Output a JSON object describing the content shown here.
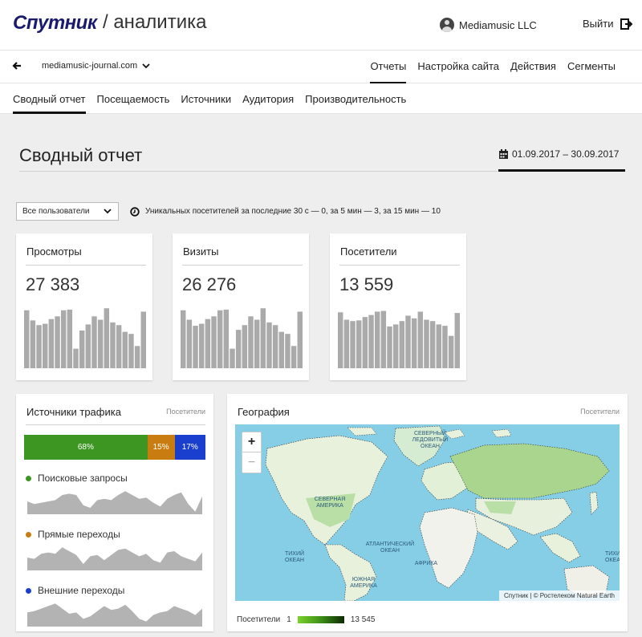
{
  "header": {
    "logo": "Спутник",
    "section": "/ аналитика",
    "account": "Mediamusic LLC",
    "logout": "Выйти"
  },
  "nav": {
    "site": "mediamusic-journal.com",
    "tabs": [
      "Отчеты",
      "Настройка сайта",
      "Действия",
      "Сегменты"
    ],
    "subtabs": [
      "Сводный отчет",
      "Посещаемость",
      "Источники",
      "Аудитория",
      "Производительность"
    ]
  },
  "page": {
    "title": "Сводный отчет",
    "date_range": "01.09.2017 – 30.09.2017"
  },
  "filter": {
    "segment": "Все пользователи",
    "realtime": "Уникальных посетителей за последние 30 с — 0, за 5 мин — 3, за 15 мин — 10"
  },
  "metrics": [
    {
      "title": "Просмотры",
      "value": "27 383",
      "bars": [
        0.86,
        0.71,
        0.64,
        0.66,
        0.73,
        0.77,
        0.86,
        0.87,
        0.29,
        0.56,
        0.65,
        0.77,
        0.72,
        0.89,
        0.68,
        0.64,
        0.54,
        0.51,
        0.33,
        0.84
      ]
    },
    {
      "title": "Визиты",
      "value": "26 276",
      "bars": [
        0.86,
        0.72,
        0.63,
        0.66,
        0.73,
        0.77,
        0.86,
        0.87,
        0.29,
        0.57,
        0.64,
        0.77,
        0.72,
        0.89,
        0.68,
        0.64,
        0.54,
        0.51,
        0.33,
        0.84
      ]
    },
    {
      "title": "Посетители",
      "value": "13 559",
      "bars": [
        0.83,
        0.72,
        0.7,
        0.71,
        0.76,
        0.79,
        0.84,
        0.85,
        0.62,
        0.65,
        0.7,
        0.78,
        0.74,
        0.84,
        0.72,
        0.7,
        0.65,
        0.63,
        0.48,
        0.82
      ]
    }
  ],
  "traffic": {
    "title": "Источники трафика",
    "subtitle": "Посетители",
    "segments": [
      {
        "label": "68%",
        "share": 0.68,
        "color": "#3c9621"
      },
      {
        "label": "15%",
        "share": 0.15,
        "color": "#c97d11"
      },
      {
        "label": "17%",
        "share": 0.17,
        "color": "#1a3fcf"
      }
    ],
    "sources": [
      {
        "name": "Поисковые запросы",
        "color": "#3c9621",
        "spark": [
          0.5,
          0.4,
          0.45,
          0.5,
          0.55,
          0.75,
          0.8,
          0.75,
          0.35,
          0.25,
          0.55,
          0.6,
          0.55,
          0.75,
          0.9,
          0.75,
          0.6,
          0.65,
          0.45,
          0.3,
          0.6,
          0.75,
          0.85,
          0.4,
          0.1,
          0.7
        ]
      },
      {
        "name": "Прямые переходы",
        "color": "#c97d11",
        "spark": [
          0.5,
          0.45,
          0.65,
          0.7,
          0.65,
          0.9,
          0.75,
          0.6,
          0.25,
          0.55,
          0.6,
          0.4,
          0.6,
          0.8,
          0.85,
          0.7,
          0.55,
          0.65,
          0.4,
          0.3,
          0.7,
          0.75,
          0.55,
          0.45,
          0.35,
          0.7
        ]
      },
      {
        "name": "Внешние переходы",
        "color": "#1a3fcf",
        "spark": [
          0.55,
          0.6,
          0.7,
          0.8,
          0.9,
          0.7,
          0.5,
          0.55,
          0.3,
          0.4,
          0.6,
          0.8,
          0.65,
          0.7,
          0.85,
          0.6,
          0.3,
          0.2,
          0.45,
          0.55,
          0.6,
          0.8,
          0.7,
          0.6,
          0.45,
          0.7
        ]
      }
    ]
  },
  "geo": {
    "title": "География",
    "subtitle": "Посетители",
    "zoom_in": "+",
    "zoom_out": "−",
    "attribution": "Спутник | © Ростелеком  Natural Earth",
    "legend_label": "Посетители",
    "legend_min": "1",
    "legend_max": "13 545",
    "labels": {
      "arctic": "СЕВЕРНЫЙ ЛЕДОВИТЫЙ ОКЕАН",
      "namerica": "СЕВЕРНАЯ АМЕРИКА",
      "atlantic": "АТЛАНТИЧЕСКИЙ ОКЕАН",
      "pacific": "ТИХИЙ ОКЕАН",
      "pacific2": "ТИХИЙ ОКЕАН",
      "africa": "АФРИКА",
      "samerica": "ЮЖНАЯ АМЕРИКА"
    }
  }
}
